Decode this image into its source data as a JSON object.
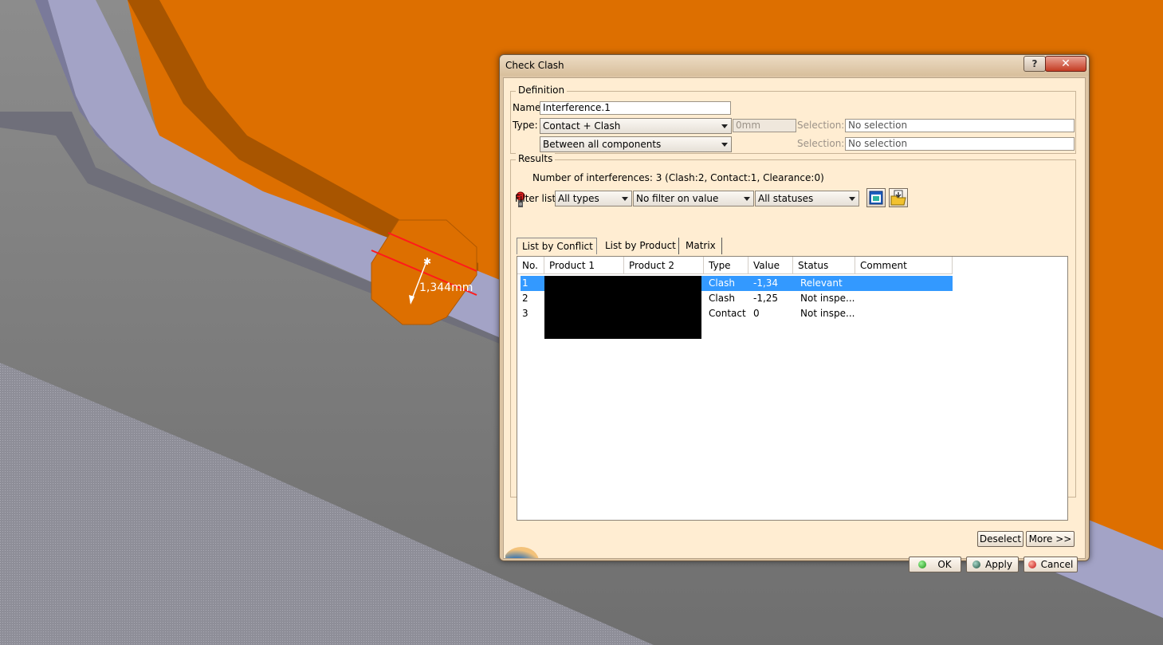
{
  "viewport": {
    "dimension_label": "1,344mm"
  },
  "dialog": {
    "title": "Check Clash",
    "help_label": "?",
    "close_label": "✕",
    "definition": {
      "legend": "Definition",
      "name_label": "Name:",
      "name_value": "Interference.1",
      "type_label": "Type:",
      "type_value": "Contact + Clash",
      "clearance_value": "0mm",
      "mode_value": "Between all components",
      "selection1_label": "Selection: 1",
      "selection1_value": "No selection",
      "selection2_label": "Selection: 2",
      "selection2_value": "No selection"
    },
    "results": {
      "legend": "Results",
      "summary": "Number of interferences: 3 (Clash:2, Contact:1, Clearance:0)",
      "filter_label": "Filter list:",
      "filter_types": "All types",
      "filter_value": "No filter on value",
      "filter_status": "All statuses",
      "tabs": [
        "List by Conflict",
        "List by Product",
        "Matrix"
      ],
      "columns": [
        "No.",
        "Product 1",
        "Product 2",
        "Type",
        "Value",
        "Status",
        "Comment"
      ],
      "rows": [
        {
          "no": "1",
          "type": "Clash",
          "value": "-1,34",
          "status": "Relevant",
          "comment": ""
        },
        {
          "no": "2",
          "type": "Clash",
          "value": "-1,25",
          "status": "Not inspe...",
          "comment": ""
        },
        {
          "no": "3",
          "type": "Contact",
          "value": "0",
          "status": "Not inspe...",
          "comment": ""
        }
      ],
      "deselect_label": "Deselect",
      "more_label": "More >>"
    },
    "ok_label": "OK",
    "apply_label": "Apply",
    "cancel_label": "Cancel"
  },
  "colors": {
    "orange_part": "#dd6f00",
    "selection_blue": "#3399ff",
    "dialog_face": "#ffedd2"
  }
}
